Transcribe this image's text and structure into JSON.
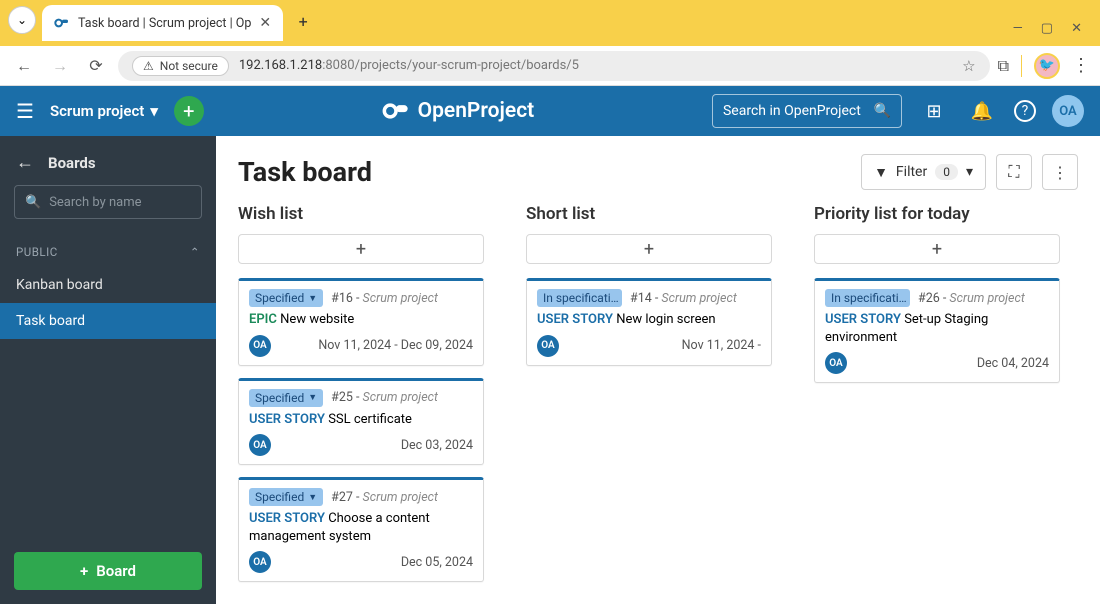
{
  "browser": {
    "tab_title": "Task board | Scrum project | Op",
    "insecure_label": "Not secure",
    "url_host": "192.168.1.218",
    "url_port": ":8080",
    "url_path": "/projects/your-scrum-project/boards/5"
  },
  "header": {
    "project_name": "Scrum project",
    "brand": "OpenProject",
    "search_placeholder": "Search in OpenProject",
    "avatar_initials": "OA"
  },
  "sidebar": {
    "back_label": "Boards",
    "search_placeholder": "Search by name",
    "section_label": "PUBLIC",
    "items": [
      {
        "label": "Kanban board",
        "active": false
      },
      {
        "label": "Task board",
        "active": true
      }
    ],
    "footer_button": "Board"
  },
  "board": {
    "title": "Task board",
    "filter_label": "Filter",
    "filter_count": "0",
    "columns": [
      {
        "title": "Wish list",
        "cards": [
          {
            "status": "Specified",
            "id": "#16",
            "project": "Scrum project",
            "type": "EPIC",
            "type_class": "epic",
            "title": "New website",
            "assignee": "OA",
            "dates": "Nov 11, 2024 - Dec 09, 2024"
          },
          {
            "status": "Specified",
            "id": "#25",
            "project": "Scrum project",
            "type": "USER STORY",
            "type_class": "us",
            "title": "SSL certificate",
            "assignee": "OA",
            "dates": "Dec 03, 2024"
          },
          {
            "status": "Specified",
            "id": "#27",
            "project": "Scrum project",
            "type": "USER STORY",
            "type_class": "us",
            "title": "Choose a content management system",
            "assignee": "OA",
            "dates": "Dec 05, 2024"
          }
        ]
      },
      {
        "title": "Short list",
        "cards": [
          {
            "status": "In specificati…",
            "id": "#14",
            "project": "Scrum project",
            "type": "USER STORY",
            "type_class": "us",
            "title": "New login screen",
            "assignee": "OA",
            "dates": "Nov 11, 2024 -"
          }
        ]
      },
      {
        "title": "Priority list for today",
        "cards": [
          {
            "status": "In specificati…",
            "id": "#26",
            "project": "Scrum project",
            "type": "USER STORY",
            "type_class": "us",
            "title": "Set-up Staging environment",
            "assignee": "OA",
            "dates": "Dec 04, 2024"
          }
        ]
      }
    ]
  }
}
